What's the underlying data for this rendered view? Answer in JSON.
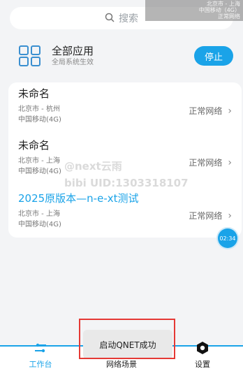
{
  "search": {
    "placeholder": "搜索"
  },
  "status_overlay": {
    "line1": "北京市 - 上海",
    "line2": "中国移动（4G）",
    "line3": "正常网络"
  },
  "apps": {
    "title": "全部应用",
    "subtitle": "全局系统生效",
    "stop_label": "停止"
  },
  "scenes": [
    {
      "name": "未命名",
      "location": "北京市 - 杭州",
      "carrier": "中国移动(4G)",
      "network": "正常网络"
    },
    {
      "name": "未命名",
      "location": "北京市 - 上海",
      "carrier": "中国移动(4G)",
      "network": "正常网络"
    },
    {
      "name": "2025原版本—n-e-xt测试",
      "location": "北京市 - 上海",
      "carrier": "中国移动(4G)",
      "network": "正常网络"
    }
  ],
  "time_bubble": "02:34",
  "watermark": {
    "line1": "@next云雨",
    "line2": "bibi UID:1303318107"
  },
  "toast": "启动QNET成功",
  "nav": [
    {
      "label": "工作台",
      "icon": "workbench-icon"
    },
    {
      "label": "网络场景",
      "icon": "network-scene-icon"
    },
    {
      "label": "设置",
      "icon": "settings-icon"
    }
  ],
  "colors": {
    "accent": "#1aa3e8",
    "toast_border": "#e53935"
  }
}
